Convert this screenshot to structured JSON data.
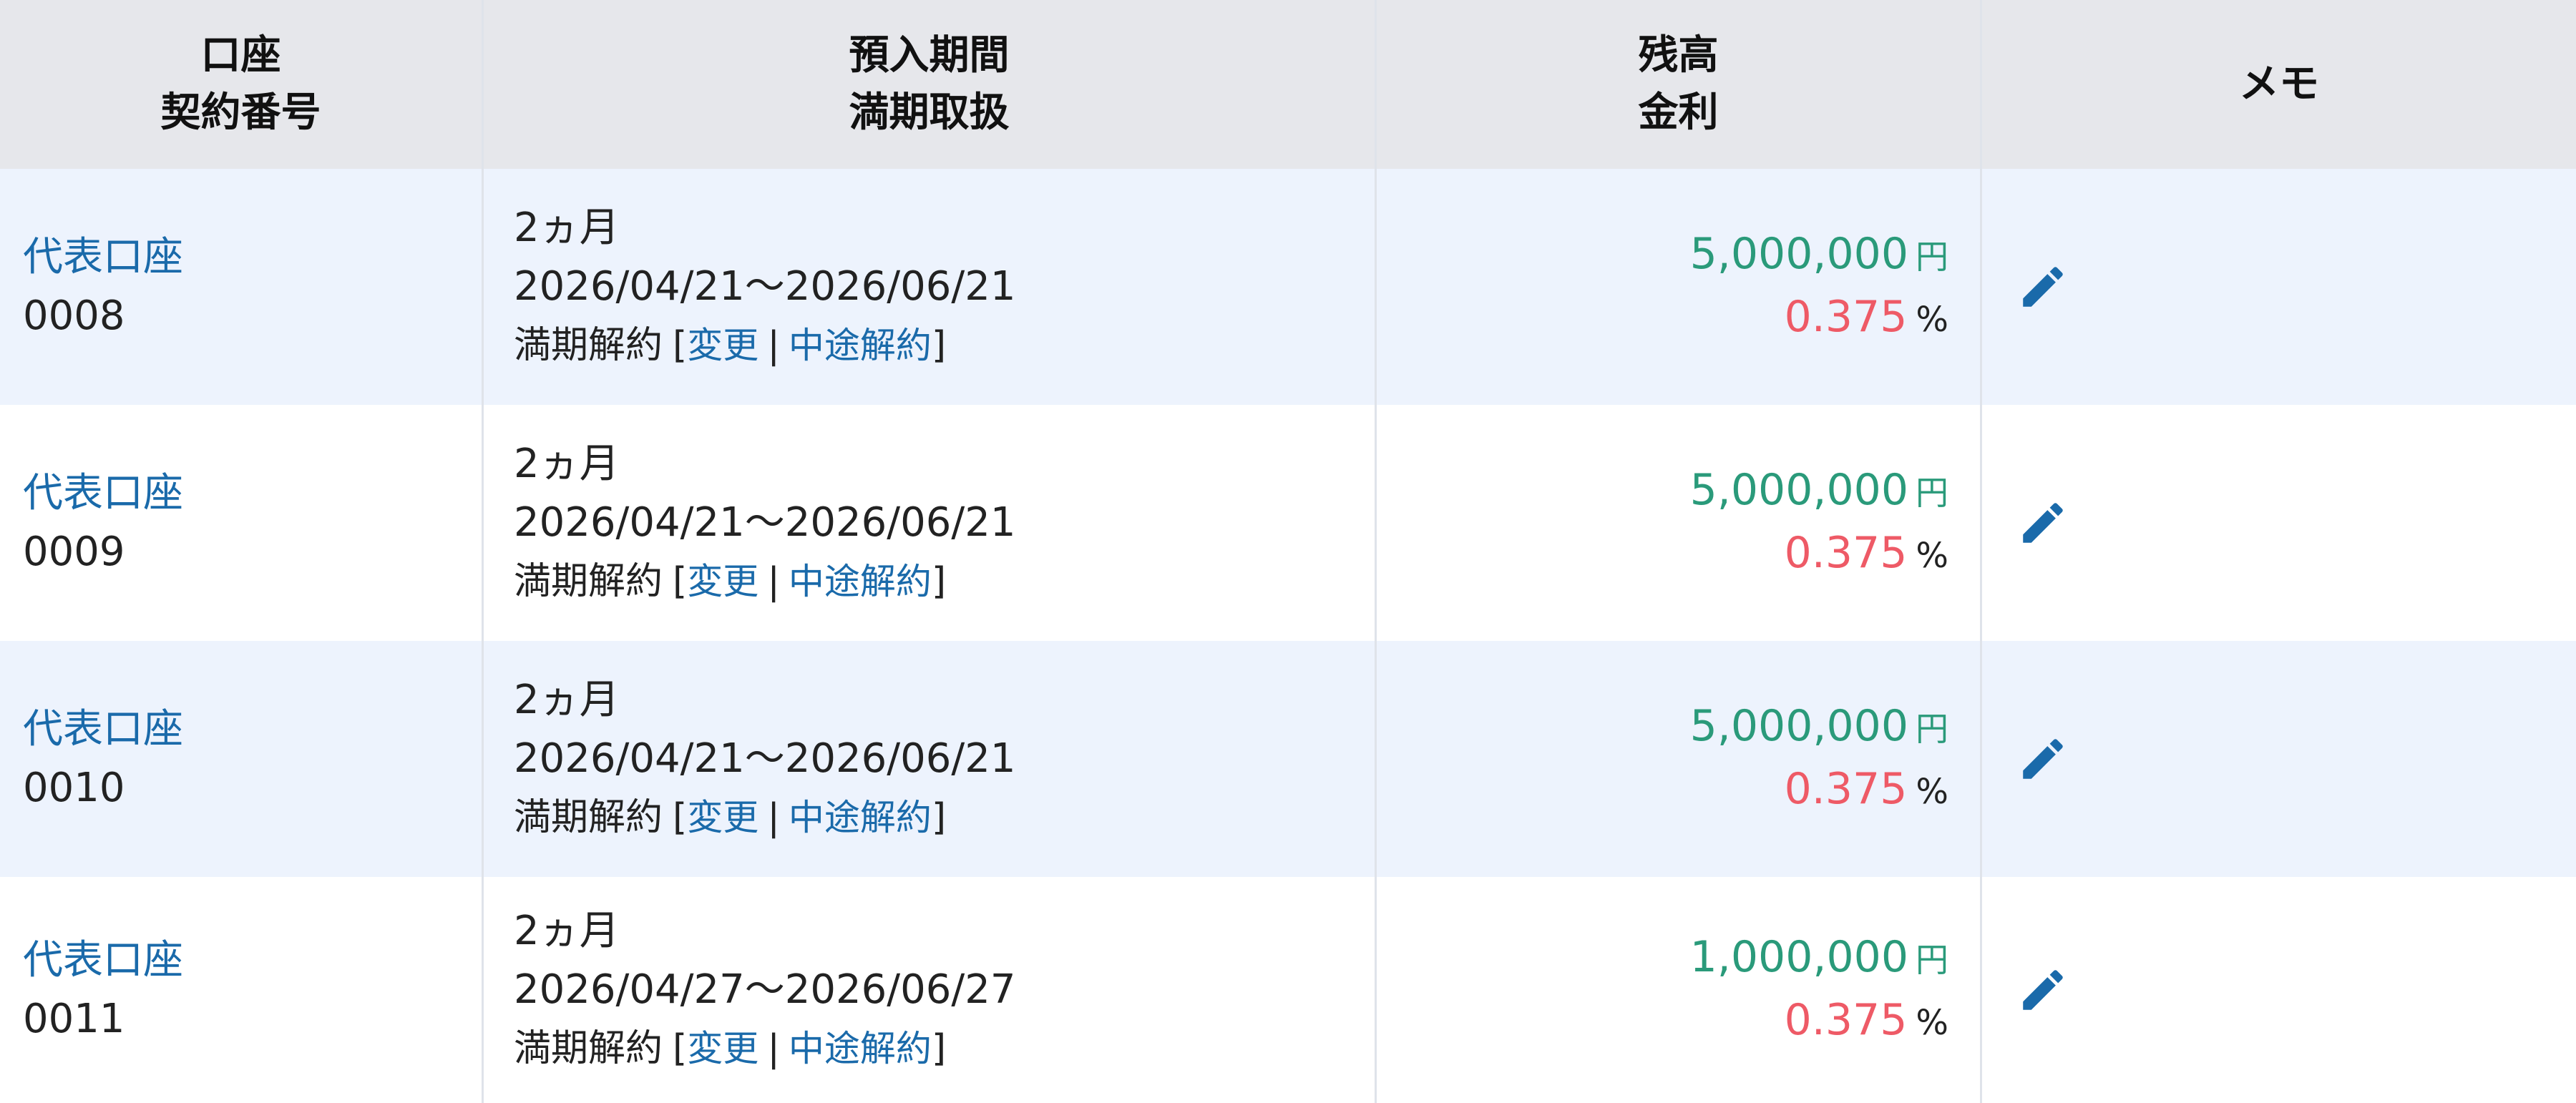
{
  "header": {
    "col1_line1": "口座",
    "col1_line2": "契約番号",
    "col2_line1": "預入期間",
    "col2_line2": "満期取扱",
    "col3_line1": "残高",
    "col3_line2": "金利",
    "col4": "メモ"
  },
  "rows": [
    {
      "account": "代表口座",
      "contract_no": "0008",
      "duration": "2ヵ月",
      "period": "2026/04/21～2026/06/21",
      "maturity": "満期解約",
      "bracket_open": "[",
      "change_label": "変更",
      "separator": "|",
      "cancel_label": "中途解約",
      "bracket_close": "]",
      "balance": "5,000,000",
      "currency": "円",
      "rate": "0.375",
      "rate_unit": "%"
    },
    {
      "account": "代表口座",
      "contract_no": "0009",
      "duration": "2ヵ月",
      "period": "2026/04/21～2026/06/21",
      "maturity": "満期解約",
      "bracket_open": "[",
      "change_label": "変更",
      "separator": "|",
      "cancel_label": "中途解約",
      "bracket_close": "]",
      "balance": "5,000,000",
      "currency": "円",
      "rate": "0.375",
      "rate_unit": "%"
    },
    {
      "account": "代表口座",
      "contract_no": "0010",
      "duration": "2ヵ月",
      "period": "2026/04/21～2026/06/21",
      "maturity": "満期解約",
      "bracket_open": "[",
      "change_label": "変更",
      "separator": "|",
      "cancel_label": "中途解約",
      "bracket_close": "]",
      "balance": "5,000,000",
      "currency": "円",
      "rate": "0.375",
      "rate_unit": "%"
    },
    {
      "account": "代表口座",
      "contract_no": "0011",
      "duration": "2ヵ月",
      "period": "2026/04/27～2026/06/27",
      "maturity": "満期解約",
      "bracket_open": "[",
      "change_label": "変更",
      "separator": "|",
      "cancel_label": "中途解約",
      "bracket_close": "]",
      "balance": "1,000,000",
      "currency": "円",
      "rate": "0.375",
      "rate_unit": "%"
    }
  ],
  "icons": {
    "memo": "pencil-icon"
  },
  "colors": {
    "link": "#1a6aaa",
    "balance": "#2a9a7a",
    "rate": "#ee5a66",
    "header_bg": "#e6e7eb",
    "row_alt_bg": "#edf3fd"
  }
}
